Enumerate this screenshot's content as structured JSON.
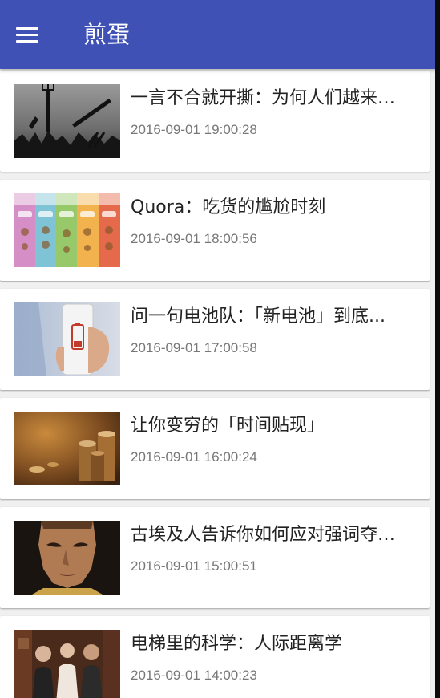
{
  "toolbar": {
    "title": "煎蛋",
    "menu_icon": "hamburger-menu-icon",
    "background_color": "#3f51b5"
  },
  "feed": {
    "items": [
      {
        "title": "一言不合就开撕：为何人们越来越...",
        "time": "2016-09-01 19:00:28",
        "thumbnail": "angry-mob-silhouettes-image"
      },
      {
        "title": "Quora：吃货的尴尬时刻",
        "time": "2016-09-01 18:00:56",
        "thumbnail": "colorful-food-chart-image"
      },
      {
        "title": "问一句电池队：「新电池」到底...",
        "time": "2016-09-01 17:00:58",
        "thumbnail": "phone-low-battery-image"
      },
      {
        "title": "让你变穷的「时间贴现」",
        "time": "2016-09-01 16:00:24",
        "thumbnail": "coin-stacks-image"
      },
      {
        "title": "古埃及人告诉你如何应对强词夺理...",
        "time": "2016-09-01 15:00:51",
        "thumbnail": "egyptian-bust-image"
      },
      {
        "title": "电梯里的科学：人际距离学",
        "time": "2016-09-01 14:00:23",
        "thumbnail": "elevator-people-image"
      }
    ]
  }
}
